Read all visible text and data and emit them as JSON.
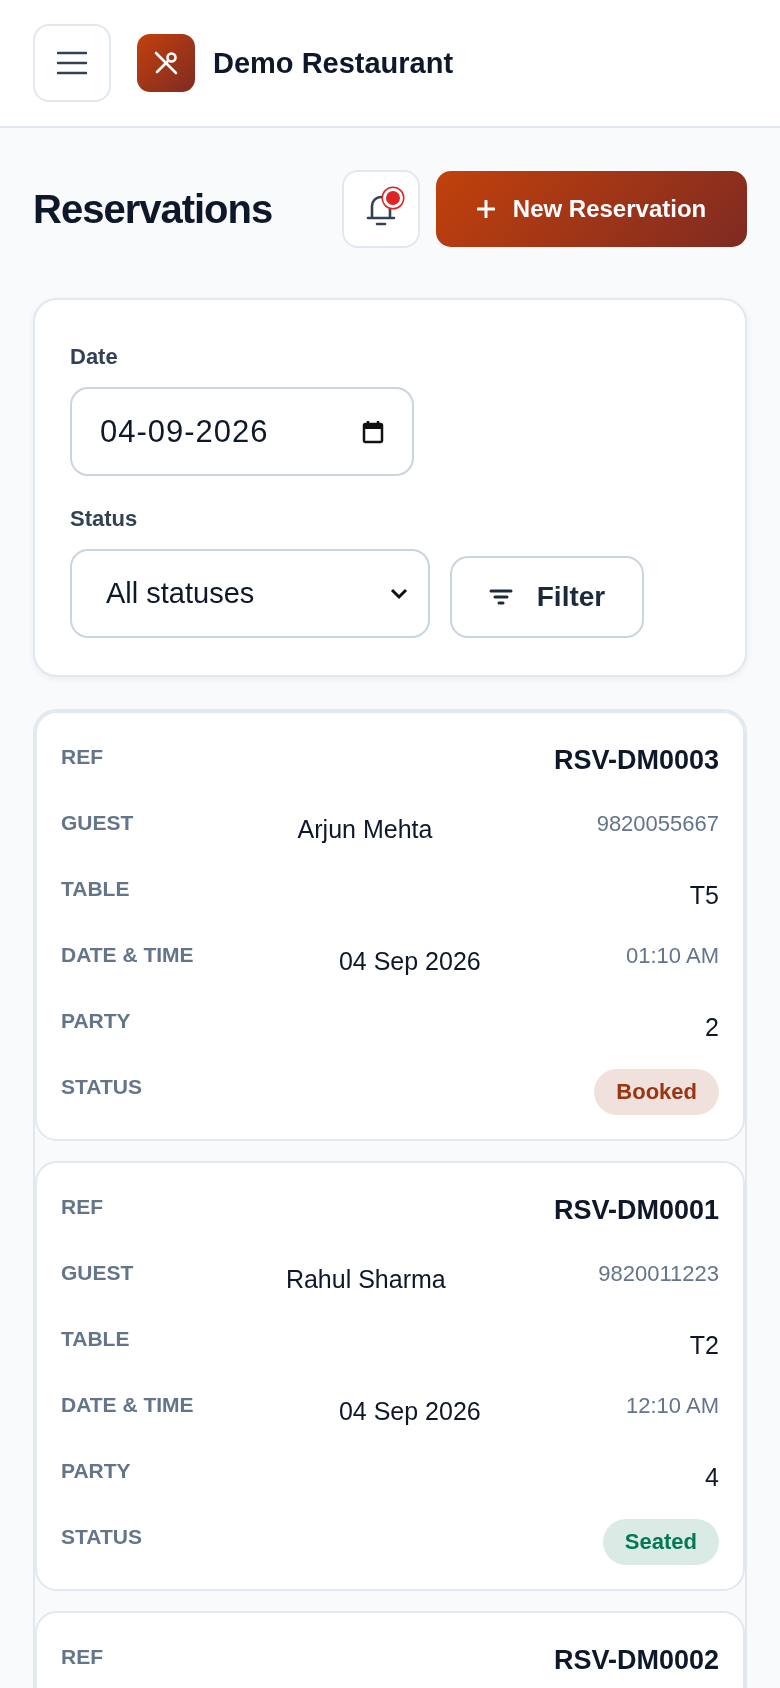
{
  "header": {
    "title": "Demo Restaurant"
  },
  "page": {
    "title": "Reservations",
    "notifications": {
      "unread": true
    },
    "new_button": "New Reservation"
  },
  "filters": {
    "date": {
      "label": "Date",
      "value": "04-09-2026"
    },
    "status": {
      "label": "Status",
      "value": "All statuses"
    },
    "button": "Filter"
  },
  "reservations": [
    {
      "fields": [
        {
          "label": "REF",
          "kind": "ref",
          "value": "RSV-DM0003"
        },
        {
          "label": "GUEST",
          "kind": "pair",
          "value": "Arjun Mehta",
          "sub": "9820055667"
        },
        {
          "label": "TABLE",
          "kind": "plain",
          "value": "T5"
        },
        {
          "label": "DATE & TIME",
          "kind": "pair",
          "value": "04 Sep 2026",
          "sub": "01:10 AM"
        },
        {
          "label": "PARTY",
          "kind": "plain",
          "value": "2"
        },
        {
          "label": "STATUS",
          "kind": "status",
          "value": "Booked",
          "color": "#9a3412"
        }
      ]
    },
    {
      "fields": [
        {
          "label": "REF",
          "kind": "ref",
          "value": "RSV-DM0001"
        },
        {
          "label": "GUEST",
          "kind": "pair",
          "value": "Rahul Sharma",
          "sub": "9820011223"
        },
        {
          "label": "TABLE",
          "kind": "plain",
          "value": "T2"
        },
        {
          "label": "DATE & TIME",
          "kind": "pair",
          "value": "04 Sep 2026",
          "sub": "12:10 AM"
        },
        {
          "label": "PARTY",
          "kind": "plain",
          "value": "4"
        },
        {
          "label": "STATUS",
          "kind": "status",
          "value": "Seated",
          "color": "#047857"
        }
      ]
    },
    {
      "fields": [
        {
          "label": "REF",
          "kind": "ref",
          "value": "RSV-DM0002"
        }
      ]
    }
  ]
}
